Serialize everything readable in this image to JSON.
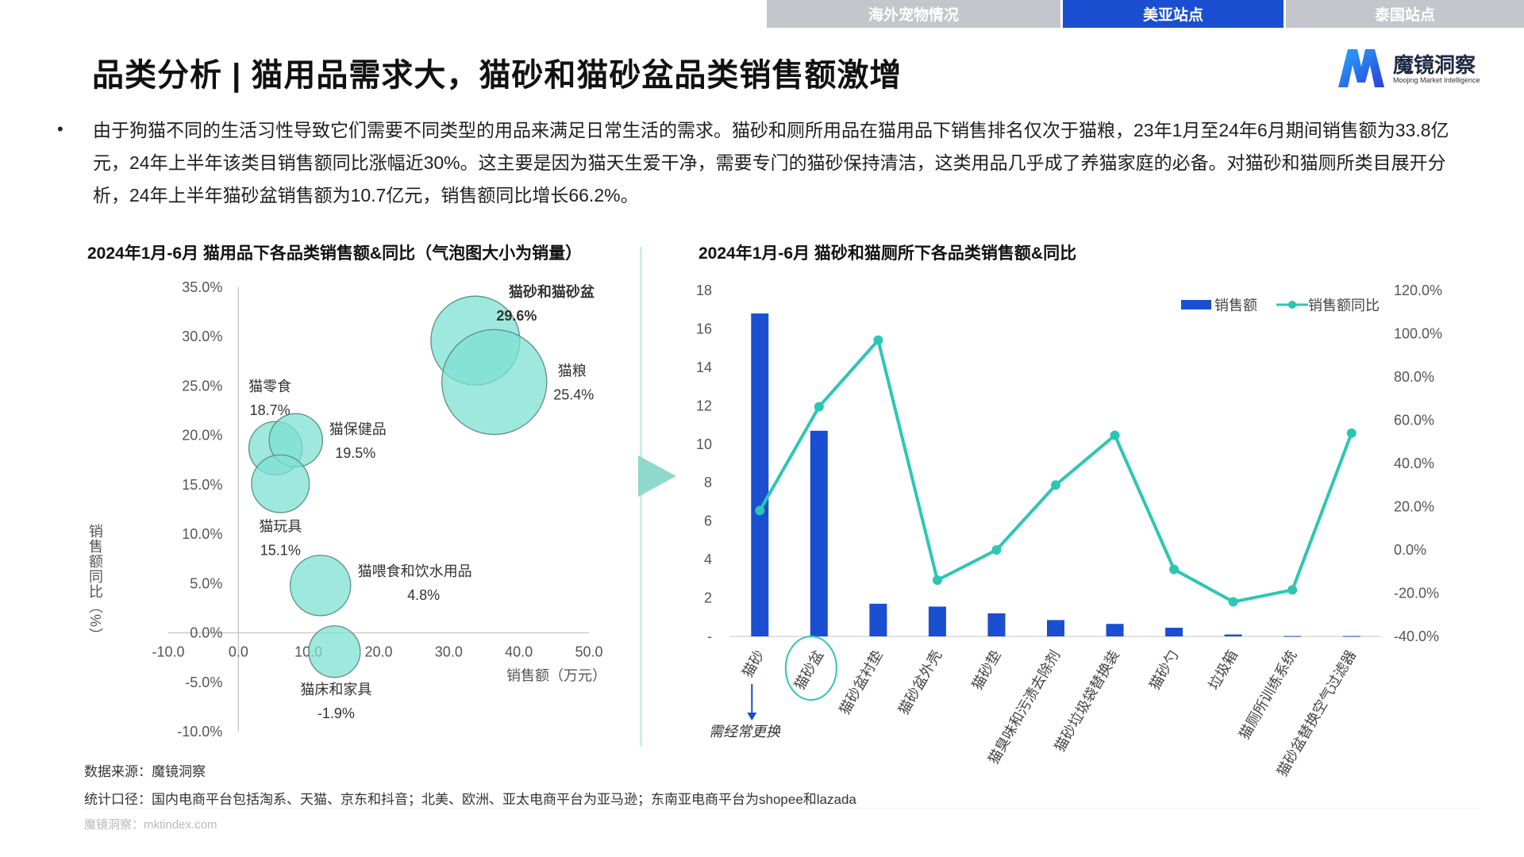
{
  "nav_tabs": [
    "海外宠物情况",
    "美亚站点",
    "泰国站点"
  ],
  "title": "品类分析 | 猫用品需求大，猫砂和猫砂盆品类销售额激增",
  "logo": {
    "name": "魔镜洞察",
    "subtitle": "Moojing Market Intelligence"
  },
  "bullet": "由于狗猫不同的生活习性导致它们需要不同类型的用品来满足日常生活的需求。猫砂和厕所用品在猫用品下销售排名仅次于猫粮，23年1月至24年6月期间销售额为33.8亿元，24年上半年该类目销售额同比涨幅近30%。这主要是因为猫天生爱干净，需要专门的猫砂保持清洁，这类用品几乎成了养猫家庭的必备。对猫砂和猫厕所类目展开分析，24年上半年猫砂盆销售额为10.7亿元，销售额同比增长66.2%。",
  "colors": {
    "accent": "#1a4fd1",
    "teal": "#2dc6b4",
    "bubble": "#7de0d3",
    "bar": "#1a4fd1"
  },
  "chart_data": [
    {
      "type": "scatter",
      "title": "2024年1月-6月 猫用品下各品类销售额&同比（气泡图大小为销量）",
      "xlabel": "销售额（万元）",
      "ylabel": "销售额同比（%）",
      "xlim": [
        -10,
        50
      ],
      "ylim": [
        -10,
        35
      ],
      "x_ticks": [
        "-10.0",
        "0.0",
        "10.0",
        "20.0",
        "30.0",
        "40.0",
        "50.0"
      ],
      "y_ticks": [
        "35.0%",
        "30.0%",
        "25.0%",
        "20.0%",
        "15.0%",
        "10.0%",
        "5.0%",
        "0.0%",
        "-5.0%",
        "-10.0%"
      ],
      "points": [
        {
          "name": "猫砂和猫砂盆",
          "value_label": "29.6%",
          "x": 33.8,
          "y": 29.6,
          "size": 1.0,
          "bold": true
        },
        {
          "name": "猫粮",
          "value_label": "25.4%",
          "x": 36.5,
          "y": 25.4,
          "size": 1.18,
          "bold": false
        },
        {
          "name": "猫零食",
          "value_label": "18.7%",
          "x": 5.3,
          "y": 18.7,
          "size": 0.6,
          "bold": false
        },
        {
          "name": "猫保健品",
          "value_label": "19.5%",
          "x": 8.2,
          "y": 19.5,
          "size": 0.6,
          "bold": false
        },
        {
          "name": "猫玩具",
          "value_label": "15.1%",
          "x": 6.0,
          "y": 15.1,
          "size": 0.65,
          "bold": false
        },
        {
          "name": "猫喂食和饮水用品",
          "value_label": "4.8%",
          "x": 11.7,
          "y": 4.8,
          "size": 0.68,
          "bold": false
        },
        {
          "name": "猫床和家具",
          "value_label": "-1.9%",
          "x": 13.7,
          "y": -1.9,
          "size": 0.58,
          "bold": false
        }
      ]
    },
    {
      "type": "bar",
      "title": "2024年1月-6月 猫砂和猫厕所下各品类销售额&同比",
      "categories": [
        "猫砂",
        "猫砂盆",
        "猫砂盆衬垫",
        "猫砂盆外壳",
        "猫砂垫",
        "猫臭味和污渍去除剂",
        "猫砂垃圾袋替换装",
        "猫砂勺",
        "垃圾箱",
        "猫厕所训练系统",
        "猫砂盆替换空气过滤器"
      ],
      "series": [
        {
          "name": "销售额",
          "axis": "left",
          "values": [
            16.8,
            10.7,
            1.7,
            1.55,
            1.2,
            0.85,
            0.65,
            0.45,
            0.1,
            0.02,
            0.02
          ]
        },
        {
          "name": "销售额同比",
          "axis": "right",
          "type": "line",
          "values": [
            18.2,
            66.2,
            97.0,
            -14.0,
            0.0,
            30.0,
            53.0,
            -9.0,
            -24.0,
            -18.5,
            54.0
          ]
        }
      ],
      "ylim_left": [
        0,
        18
      ],
      "ylim_right": [
        -40,
        120
      ],
      "y_ticks_left": [
        "-",
        "2",
        "4",
        "6",
        "8",
        "10",
        "12",
        "14",
        "16",
        "18"
      ],
      "y_ticks_right": [
        "-40.0%",
        "-20.0%",
        "0.0%",
        "20.0%",
        "40.0%",
        "60.0%",
        "80.0%",
        "100.0%",
        "120.0%"
      ],
      "legend_position": "top-right",
      "annotation": "需经常更换"
    }
  ],
  "footer": {
    "source": "数据来源：魔镜洞察",
    "scope": "统计口径：国内电商平台包括淘系、天猫、京东和抖音；北美、欧洲、亚太电商平台为亚马逊；东南亚电商平台为shopee和lazada",
    "watermark": "魔镜洞察：mktindex.com"
  }
}
